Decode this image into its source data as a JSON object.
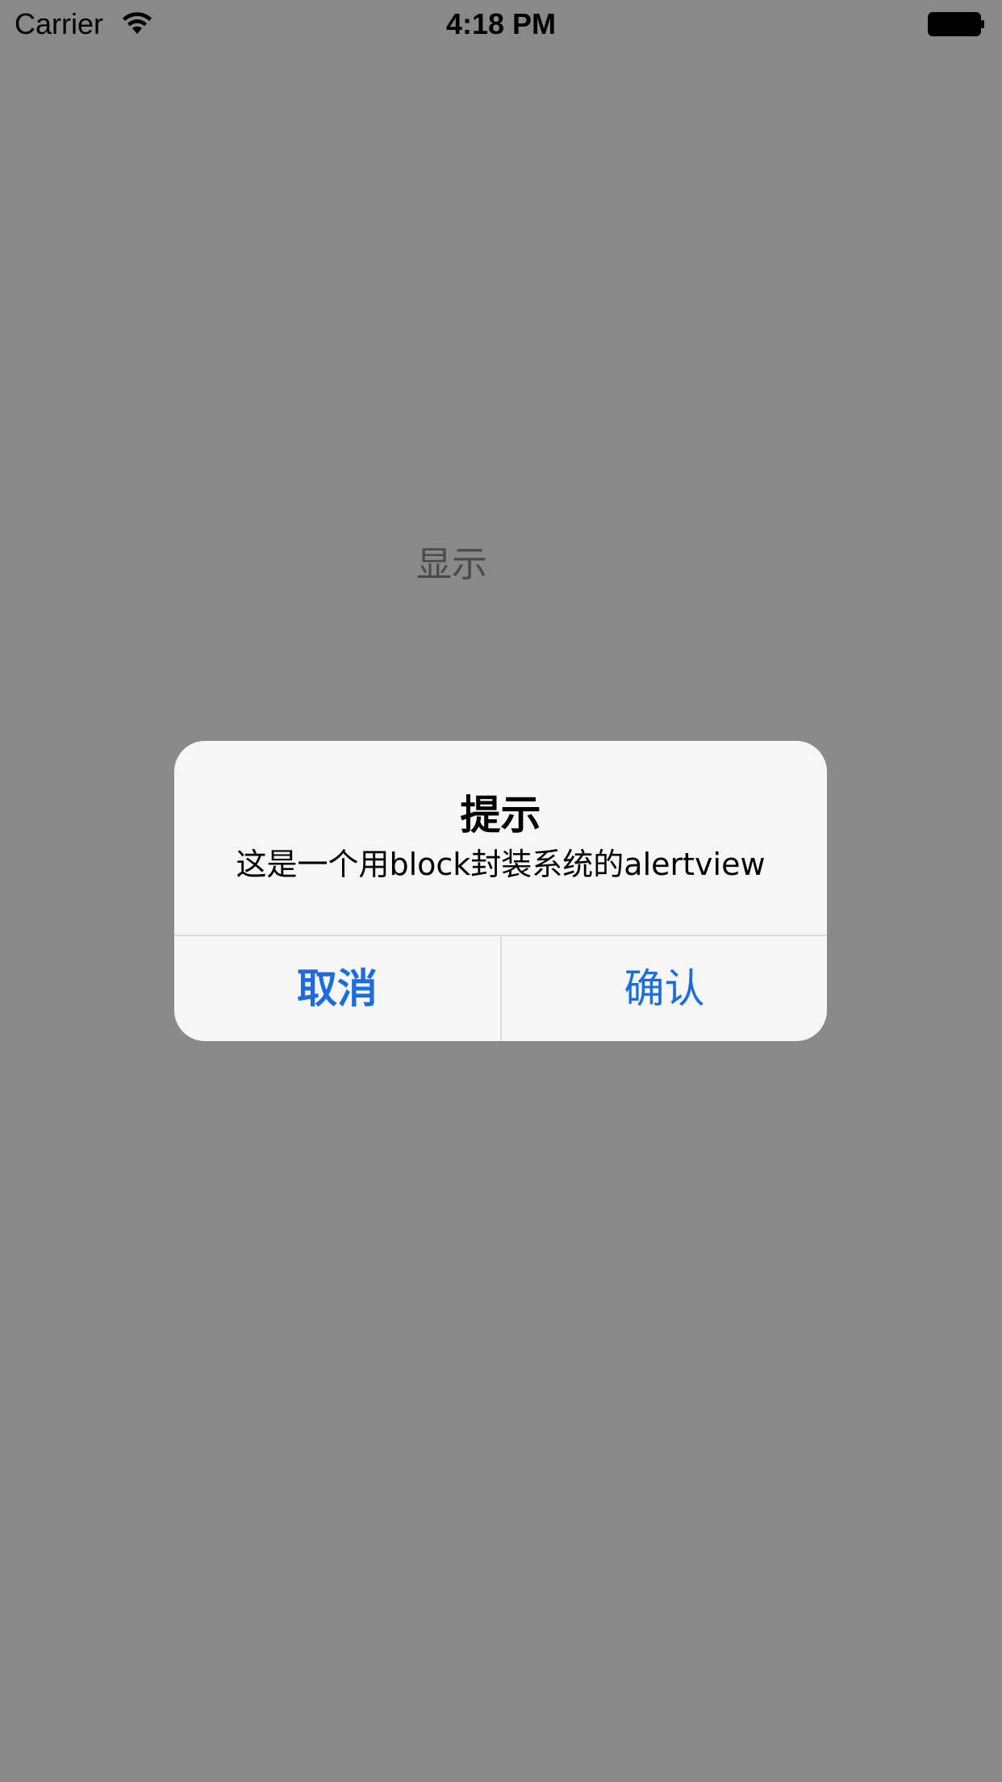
{
  "status_bar": {
    "carrier": "Carrier",
    "time": "4:18 PM",
    "wifi_icon": "wifi-icon",
    "battery_icon": "battery-icon"
  },
  "main": {
    "show_button_label": "显示",
    "background_color": "#898989"
  },
  "alert": {
    "title": "提示",
    "message": "这是一个用block封装系统的alertview",
    "cancel_label": "取消",
    "confirm_label": "确认",
    "accent_color": "#1b6ce0",
    "background_color": "#f6f6f6"
  }
}
